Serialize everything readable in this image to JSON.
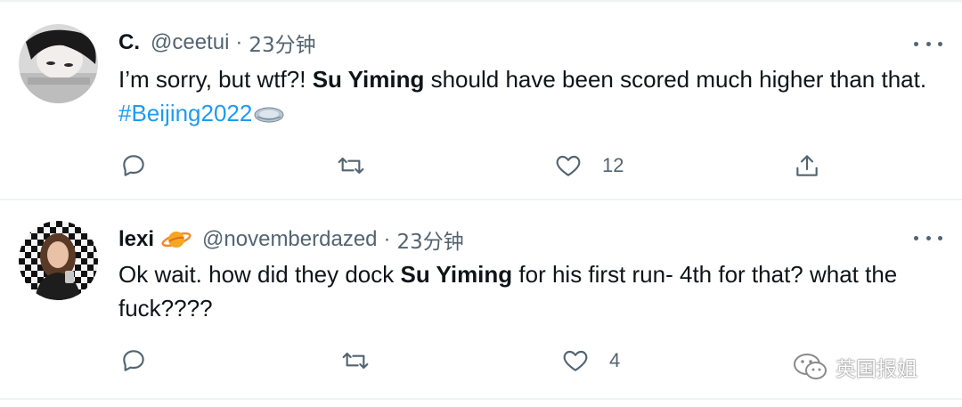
{
  "tweets": [
    {
      "name": "C.",
      "handle": "@ceetui",
      "separator": "·",
      "time": "23分钟",
      "text": {
        "part1": "I’m sorry, but wtf?! ",
        "bold": "Su Yiming",
        "part2": " should have been scored much higher than that. ",
        "hashtag": "#Beijing2022"
      },
      "counts": {
        "reply": "",
        "retweet": "",
        "like": "12"
      }
    },
    {
      "name": "lexi",
      "handle": "@novemberdazed",
      "separator": "·",
      "time": "23分钟",
      "text": {
        "part1": "Ok wait. how did they dock ",
        "bold": "Su Yiming",
        "part2": " for his first run- 4th for that? what the fuck????"
      },
      "counts": {
        "reply": "",
        "retweet": "",
        "like": "4"
      }
    }
  ],
  "watermark": {
    "text": "英国报姐"
  },
  "colors": {
    "accent": "#1d9bf0",
    "secondary_text": "#536471",
    "divider": "#eff3f4"
  }
}
